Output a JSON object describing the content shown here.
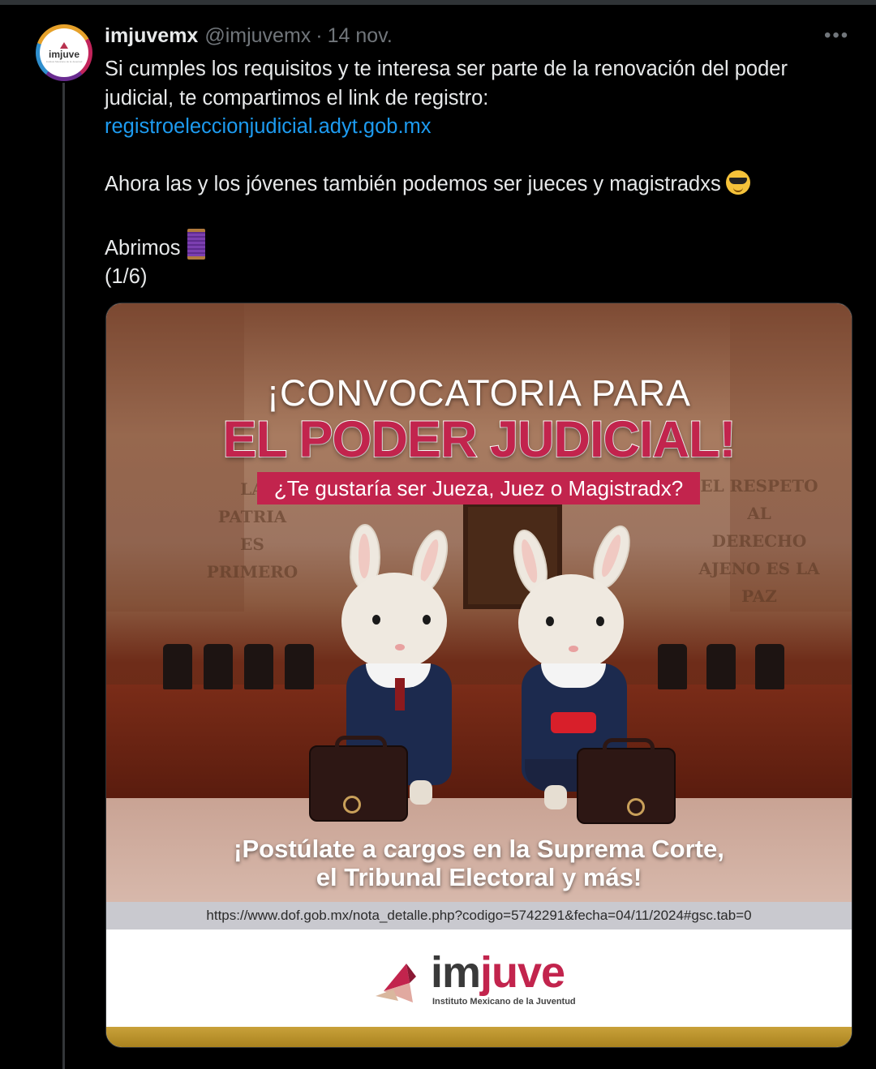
{
  "tweet": {
    "author_name": "imjuvemx",
    "author_handle": "@imjuvemx",
    "separator": "·",
    "date": "14 nov.",
    "more_label": "•••",
    "avatar_text": "imjuve",
    "avatar_subtext": "Instituto Mexicano de la Juventud",
    "text_line1": "Si cumples los requisitos y te interesa ser parte de la renovación del poder judicial, te compartimos el link de registro:",
    "link": "registroeleccionjudicial.adyt.gob.mx",
    "text_line2": "Ahora las y los jóvenes también podemos ser jueces y magistradxs",
    "text_line3": "Abrimos",
    "text_line4": "(1/6)",
    "emoji_1": "smiling-face-with-sunglasses",
    "emoji_2": "thread-spool"
  },
  "media": {
    "title_top": "¡CONVOCATORIA PARA",
    "title_main": "EL PODER JUDICIAL!",
    "subtitle": "¿Te gustaría ser Jueza, Juez o Magistradx?",
    "wall_left": "LA PATRIA ES PRIMERO",
    "wall_right": "EL RESPETO AL DERECHO AJENO ES LA PAZ",
    "cta_line1": "¡Postúlate a cargos en la Suprema Corte,",
    "cta_line2": "el Tribunal Electoral y más!",
    "url": "https://www.dof.gob.mx/nota_detalle.php?codigo=5742291&fecha=04/11/2024#gsc.tab=0",
    "logo_im": "im",
    "logo_juve": "juve",
    "logo_sub": "Instituto Mexicano de la Juventud"
  },
  "colors": {
    "background": "#000000",
    "text": "#e7e9ea",
    "muted": "#71767b",
    "link": "#1d9bf0",
    "brand_magenta": "#c2244d",
    "brand_gold": "#c9a13a"
  }
}
